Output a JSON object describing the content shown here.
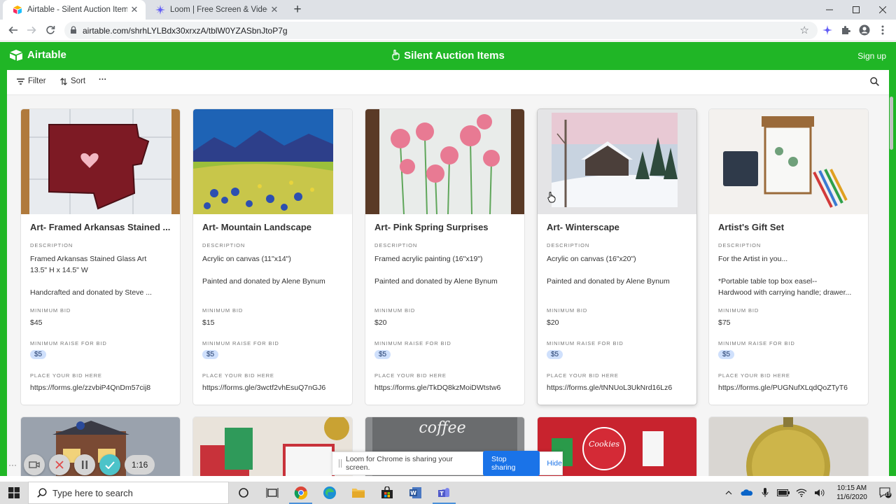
{
  "browser": {
    "tabs": [
      {
        "title": "Airtable - Silent Auction Items",
        "active": true
      },
      {
        "title": "Loom | Free Screen & Video Reco",
        "active": false
      }
    ],
    "url": "airtable.com/shrhLYLBdx30xrxzA/tblW0YZASbnJtoP7g"
  },
  "header": {
    "logo": "Airtable",
    "title": "Silent Auction Items",
    "signup": "Sign up",
    "brand_color": "#20b626"
  },
  "viewbar": {
    "filter": "Filter",
    "sort": "Sort",
    "more": "···"
  },
  "labels": {
    "description": "DESCRIPTION",
    "min_bid": "MINIMUM BID",
    "min_raise": "MINIMUM RAISE FOR BID",
    "place_bid": "PLACE YOUR BID HERE"
  },
  "cards": [
    {
      "name": "Art- Framed Arkansas Stained ...",
      "desc": [
        "Framed Arkansas Stained Glass Art",
        "13.5\" H x 14.5\" W",
        "",
        "Handcrafted and donated by Steve ..."
      ],
      "min_bid": "$45",
      "min_raise": "$5",
      "bid_url": "https://forms.gle/zzvbiP4QnDm57cij8"
    },
    {
      "name": "Art- Mountain Landscape",
      "desc": [
        "Acrylic on canvas (11\"x14\")",
        "",
        "Painted and donated by Alene Bynum"
      ],
      "min_bid": "$15",
      "min_raise": "$5",
      "bid_url": "https://forms.gle/3wctf2vhEsuQ7nGJ6"
    },
    {
      "name": "Art- Pink Spring Surprises",
      "desc": [
        "Framed acrylic painting (16\"x19\")",
        "",
        "Painted and donated by Alene Bynum"
      ],
      "min_bid": "$20",
      "min_raise": "$5",
      "bid_url": "https://forms.gle/TkDQ8kzMoiDWtstw6"
    },
    {
      "name": "Art- Winterscape",
      "desc": [
        "Acrylic on canvas (16\"x20\")",
        "",
        "Painted and donated by Alene Bynum"
      ],
      "min_bid": "$20",
      "min_raise": "$5",
      "bid_url": "https://forms.gle/tNNUoL3UkNrd16Lz6"
    },
    {
      "name": "Artist's Gift Set",
      "desc": [
        "For the Artist in you...",
        "",
        "*Portable table top box easel--",
        "Hardwood with carrying handle; drawer..."
      ],
      "min_bid": "$75",
      "min_raise": "$5",
      "bid_url": "https://forms.gle/PUGNufXLqdQoZTyT6"
    }
  ],
  "loom": {
    "timer": "1:16",
    "sharing_msg": "Loom for Chrome is sharing your screen.",
    "stop": "Stop sharing",
    "hide": "Hide"
  },
  "taskbar": {
    "search_placeholder": "Type here to search",
    "time": "10:15 AM",
    "date": "11/6/2020",
    "notifications": "19"
  }
}
